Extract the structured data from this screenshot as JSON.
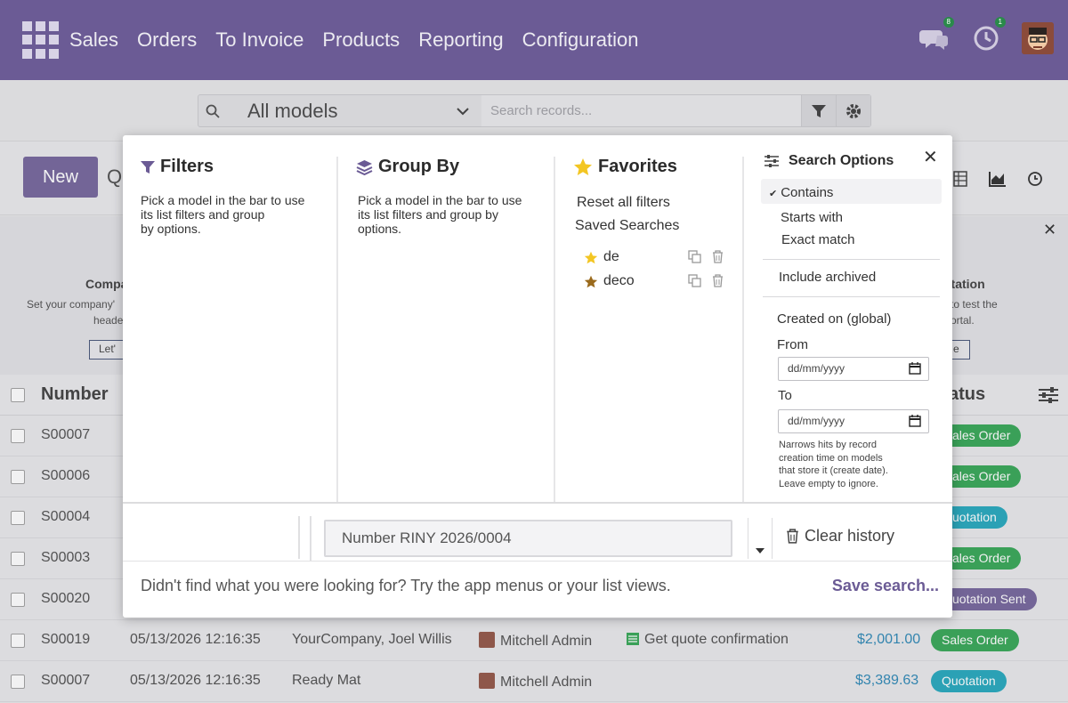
{
  "nav": {
    "items": [
      "Sales",
      "Orders",
      "To Invoice",
      "Products",
      "Reporting",
      "Configuration"
    ],
    "messages_badge": "8",
    "activity_badge": "1"
  },
  "search": {
    "model": "All models",
    "placeholder": "Search records..."
  },
  "control": {
    "new_label": "New",
    "truncated_title": "Q"
  },
  "banner": {
    "left_title": "Compa",
    "left_text_1": "Set your company'",
    "left_text_2": "heade",
    "left_button": "Let'",
    "right_title": "otation",
    "right_text_1": "to test the",
    "right_text_2": "ortal.",
    "right_button": "e"
  },
  "table": {
    "header_number": "Number",
    "header_status": "atus",
    "rows": [
      {
        "number": "S00007",
        "status": "ales Order",
        "status_color": "green"
      },
      {
        "number": "S00006",
        "status": "ales Order",
        "status_color": "green"
      },
      {
        "number": "S00004",
        "status": "uotation",
        "status_color": "teal"
      },
      {
        "number": "S00003",
        "status": "ales Order",
        "status_color": "green"
      },
      {
        "number": "S00020",
        "status": "uotation Sent",
        "status_color": "purple"
      },
      {
        "number": "S00019",
        "date": "05/13/2026 12:16:35",
        "customer": "YourCompany, Joel Willis",
        "salesperson": "Mitchell Admin",
        "activity": "Get quote confirmation",
        "amount": "$2,001.00",
        "status": "Sales Order",
        "status_color": "green"
      },
      {
        "number": "S00007",
        "date": "05/13/2026 12:16:35",
        "customer": "Ready Mat",
        "salesperson": "Mitchell Admin",
        "activity": "",
        "amount": "$3,389.63",
        "status": "Quotation",
        "status_color": "teal"
      }
    ]
  },
  "modal": {
    "filters": {
      "title": "Filters",
      "desc_1": "Pick a model in the bar to use",
      "desc_2": "its list filters and group",
      "desc_3": "by options."
    },
    "groupby": {
      "title": "Group By",
      "desc_1": "Pick a model in the bar to use",
      "desc_2": "its list filters and group by",
      "desc_3": "options."
    },
    "favorites": {
      "title": "Favorites",
      "reset": "Reset all filters",
      "saved": "Saved Searches",
      "items": [
        {
          "label": "de",
          "star_color": "#f3c623"
        },
        {
          "label": "deco",
          "star_color": "#9a6a1c"
        }
      ]
    },
    "search_options": {
      "title": "Search Options",
      "contains": "Contains",
      "starts_with": "Starts with",
      "exact_match": "Exact match",
      "include_archived": "Include archived",
      "created_on": "Created on (global)",
      "from_label": "From",
      "to_label": "To",
      "date_placeholder": "dd/mm/yyyy",
      "note_1": "Narrows hits by record",
      "note_2": "creation time on models",
      "note_3": "that store it (create date).",
      "note_4": "Leave empty to ignore."
    },
    "history_item": "Number RINY 2026/0004",
    "clear_history": "Clear history",
    "footer_text": "Didn't find what you were looking for? Try the app menus or your list views.",
    "save_search": "Save search..."
  },
  "colors": {
    "brand": "#6b5b95",
    "green": "#28a04b",
    "teal": "#17a2b8"
  }
}
